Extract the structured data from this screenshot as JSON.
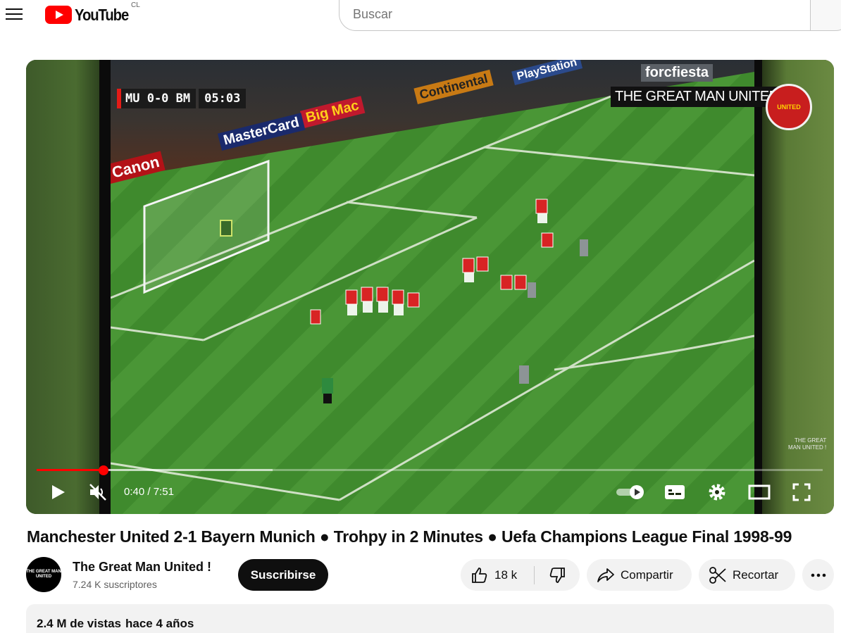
{
  "header": {
    "logo_text": "YouTube",
    "country_code": "CL",
    "search_placeholder": "Buscar"
  },
  "player": {
    "score_overlay": "MU 0-0 BM",
    "clock_overlay": "05:03",
    "watermark": "THE GREAT MAN UNITED !",
    "corner_watermark_line1": "THE GREAT",
    "corner_watermark_line2": "MAN UNITED !",
    "crest_text": "UNITED",
    "ads": {
      "canon": "Canon",
      "mastercard": "MasterCard",
      "bigmac": "Big Mac",
      "continental": "Continental",
      "playstation": "PlayStation",
      "forcfiesta": "forcfiesta"
    },
    "time_current": "0:40",
    "time_separator": " / ",
    "time_total": "7:51",
    "progress_played_fraction": 0.085,
    "progress_buffered_fraction": 0.3,
    "muted": true
  },
  "video": {
    "title": "Manchester United 2-1 Bayern Munich ● Trohpy in 2 Minutes ● Uefa Champions League Final 1998-99",
    "channel_name": "The Great Man United !",
    "subscribers": "7.24 K suscriptores",
    "avatar_text": "THE GREAT MAN UNITED",
    "subscribe_label": "Suscribirse",
    "like_count": "18 k",
    "share_label": "Compartir",
    "clip_label": "Recortar",
    "views": "2.4 M de vistas",
    "published": "hace 4 años"
  },
  "colors": {
    "brand_red": "#ff0000",
    "text_primary": "#0f0f0f",
    "text_secondary": "#606060",
    "pill_bg": "#f2f2f2"
  }
}
